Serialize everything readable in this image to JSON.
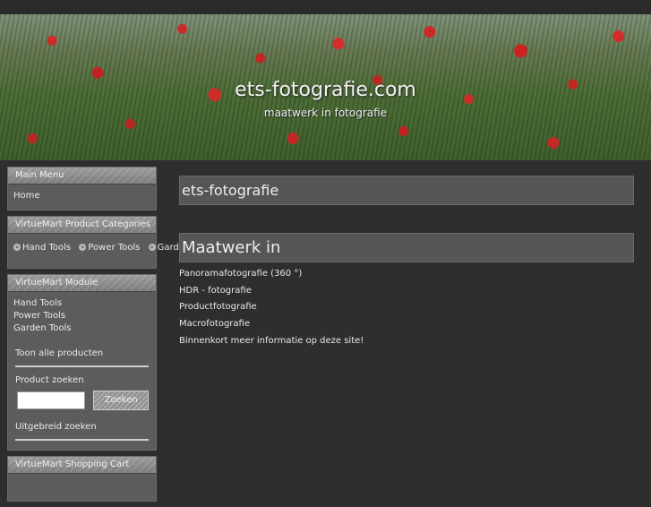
{
  "header": {
    "site_title": "ets-fotografie.com",
    "site_subtitle": "maatwerk in fotografie"
  },
  "sidebar": {
    "main_menu": {
      "title": "Main Menu",
      "items": [
        {
          "label": "Home"
        }
      ]
    },
    "product_categories": {
      "title": "VirtueMart Product Categories",
      "items": [
        {
          "label": "Hand Tools",
          "icon": "arrow-bullet-icon"
        },
        {
          "label": "Power Tools",
          "icon": "arrow-bullet-icon"
        },
        {
          "label": "Garde",
          "icon": "arrow-bullet-icon"
        }
      ]
    },
    "vm_module": {
      "title": "VirtueMart Module",
      "categories": [
        "Hand Tools",
        "Power Tools",
        "Garden Tools"
      ],
      "show_all_label": "Toon alle producten",
      "search_label": "Product zoeken",
      "search_value": "",
      "search_button_label": "Zoeken",
      "advanced_search_label": "Uitgebreid zoeken"
    },
    "shopping_cart": {
      "title": "VirtueMart Shopping Cart"
    }
  },
  "main": {
    "heading1": "ets-fotografie",
    "heading2": "Maatwerk in",
    "items": [
      "Panoramafotografie (360 °)",
      "HDR - fotografie",
      "Productfotografie",
      "Macrofotografie",
      "Binnenkort meer informatie op deze site!"
    ]
  },
  "colors": {
    "background": "#2e2e2e",
    "panel": "#5c5c5c",
    "heading_box": "#565656",
    "text": "#e6e6e6"
  }
}
